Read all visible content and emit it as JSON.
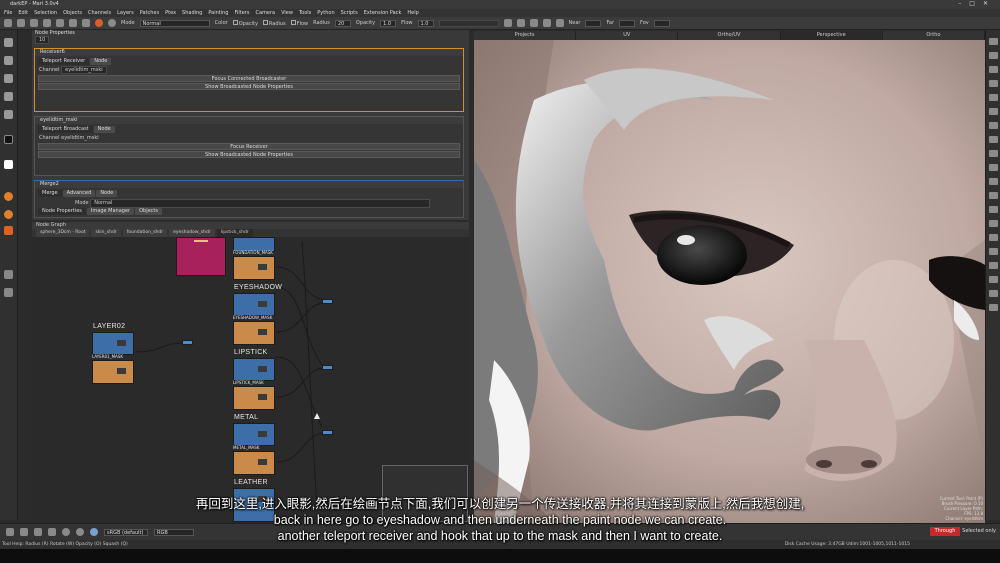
{
  "app": {
    "title": "darkEP - Mari 3.0v4"
  },
  "menubar": [
    "File",
    "Edit",
    "Selection",
    "Objects",
    "Channels",
    "Layers",
    "Patches",
    "Ptex",
    "Shading",
    "Painting",
    "Filters",
    "Camera",
    "View",
    "Tools",
    "Python",
    "Scripts",
    "Extension Pack",
    "Help"
  ],
  "toolbar": {
    "mode_label": "Mode",
    "mode_value": "Normal",
    "color_label": "Color",
    "opacity_label": "Opacity",
    "radius_label": "Radius",
    "flow_label": "Flow",
    "radius_field_label": "Radius",
    "radius_value": "20",
    "opacity_field_label": "Opacity",
    "opacity_value": "1.0",
    "flow_field_label": "Flow",
    "flow_value": "1.0",
    "near_label": "Near",
    "far_label": "Far",
    "fov_label": "Fov"
  },
  "node_properties": {
    "title": "Node Properties",
    "count_value": "10",
    "receiver": {
      "title": "Receiver6",
      "tabs": [
        "Teleport Receiver",
        "Node"
      ],
      "channel_label": "Channel",
      "channel_value": "eyelidtim_mski",
      "button1": "Focus Connected Broadcaster",
      "button2": "Show Broadcasted Node Properties"
    },
    "broadcast": {
      "title": "eyelidtim_mski",
      "tabs": [
        "Teleport Broadcast",
        "Node"
      ],
      "channel_label": "Channel",
      "channel_value": "eyelidtim_mski",
      "button1": "Focus Receiver",
      "button2": "Show Broadcasted Node Properties"
    },
    "merge": {
      "title": "Merge2",
      "tabs": [
        "Merge",
        "Advanced",
        "Node"
      ],
      "mode_label": "Mode",
      "mode_value": "Normal",
      "bottom_tabs": [
        "Node Properties",
        "Image Manager",
        "Objects"
      ]
    }
  },
  "node_graph": {
    "title": "Node Graph",
    "tabs": [
      "sphere_3Dcm - Root",
      "skin_shdr",
      "foundation_shdr",
      "eyeshadow_shdr",
      "lipstick_shdr"
    ],
    "labels": {
      "layer": "LAYER02",
      "layer_mask": "LAYER01_MASK",
      "foundation_mask": "FOUNDATION_MASK",
      "eyeshadow": "EYESHADOW",
      "eyeshadow_mask": "EYESHADOW_MASK",
      "lipstick": "LIPSTICK",
      "lipstick_mask": "LIPSTICK_MASK",
      "metal": "METAL",
      "metal_mask": "METAL_MASK",
      "leather": "LEATHER"
    }
  },
  "viewport": {
    "tabs": [
      "Projects",
      "UV",
      "Ortho/UV",
      "Perspective",
      "Ortho"
    ],
    "active_tab": "Perspective",
    "info_lines": [
      "Current Tool: Paint (P)",
      "Brush Pressure: 0.10",
      "Current Layer Path:",
      "FPS: 13.8",
      "Channel: eyelidtim"
    ]
  },
  "bottombar": {
    "colorspace": "sRGB (default)",
    "channel": "RGB",
    "through_label": "Through",
    "selected_label": "Selected only"
  },
  "statusbar": {
    "left": "Tool Help:   Radius (R)   Rotate (W)   Opacity (O)   Squash (Q)",
    "right": "Disk Cache Usage: 3.47GB   Udim:1001-1005,1011-1015"
  },
  "subtitles": {
    "cn": "再回到这里,进入眼影,然后在绘画节点下面,我们可以创建另一个传送接收器,并将其连接到蒙版上,然后我想创建,",
    "en1": "back in here go to eyeshadow and then underneath the paint node we can create.",
    "en2": "another teleport receiver and hook that up to the mask and then I want to create."
  },
  "colors": {
    "accent_selected": "#d4902a",
    "node_blue": "#3d6ea8",
    "node_orange": "#c98a4a",
    "through_red": "#c8282a"
  }
}
